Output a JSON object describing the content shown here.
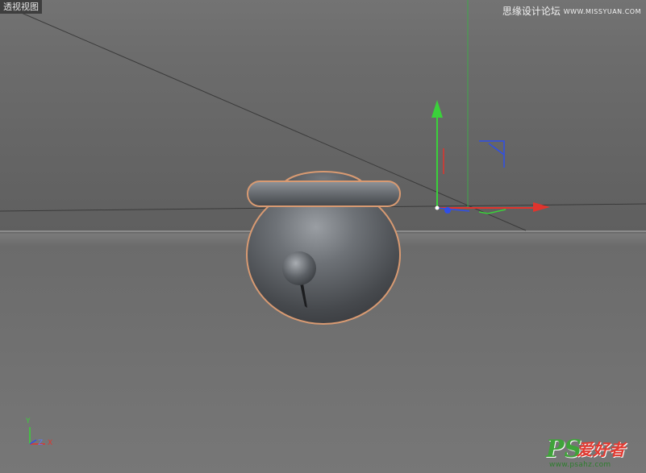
{
  "viewport": {
    "view_name": "透视视图"
  },
  "watermark": {
    "top_text": "思缘设计论坛",
    "top_site": "WWW.MISSYUAN.COM",
    "logo": "PS",
    "logo_cn": "爱好者",
    "logo_url": "www.psahz.com"
  },
  "axis_indicator": {
    "y_label": "Y",
    "z_label": "Z",
    "x_label": "X"
  },
  "colors": {
    "viewport_bg": "#6e6e6e",
    "x_axis": "#e0342d",
    "y_axis": "#3ad13a",
    "z_axis": "#2f4fe8",
    "selection_outline": "#e0a070",
    "object_base": "#5c6066"
  },
  "object": {
    "name": "bell"
  }
}
